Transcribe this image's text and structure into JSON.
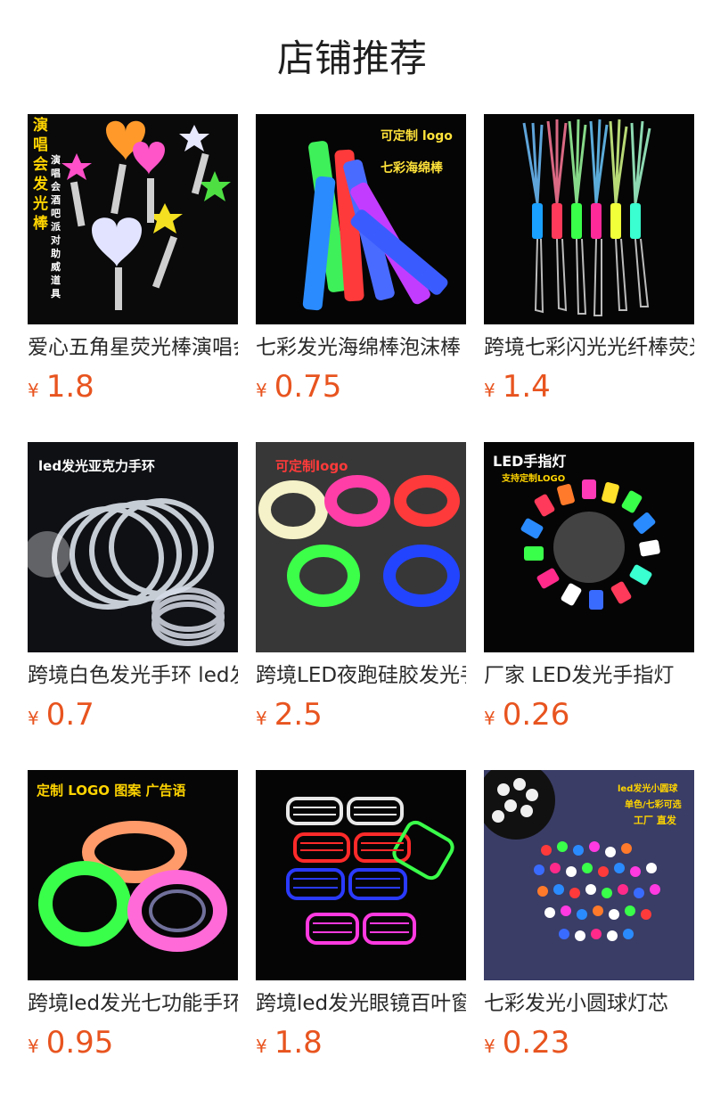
{
  "header": {
    "title": "店铺推荐"
  },
  "currency_symbol": "¥",
  "colors": {
    "price": "#e8541f",
    "title": "#1f1f1f",
    "name": "#2a2a2a"
  },
  "products": [
    {
      "name": "爱心五角星荧光棒演唱会酒吧派对助威道具",
      "price": "1.8",
      "image_text": [
        "演唱会发光棒",
        "演唱会酒吧派对助威道具"
      ],
      "icon": "heart-star-glow-stick-image"
    },
    {
      "name": "七彩发光海绵棒泡沫棒",
      "price": "0.75",
      "image_text": [
        "可定制 logo",
        "七彩海绵棒"
      ],
      "icon": "foam-stick-image"
    },
    {
      "name": "跨境七彩闪光光纤棒荧光棒",
      "price": "1.4",
      "image_text": [],
      "icon": "fiber-optic-wand-image"
    },
    {
      "name": "跨境白色发光手环 led发光亚克力手环",
      "price": "0.7",
      "image_text": [
        "led发光亚克力手环"
      ],
      "icon": "acrylic-bracelet-image"
    },
    {
      "name": "跨境LED夜跑硅胶发光手环",
      "price": "2.5",
      "image_text": [
        "可定制logo"
      ],
      "icon": "silicone-bracelet-image"
    },
    {
      "name": "厂家 LED发光手指灯",
      "price": "0.26",
      "image_text": [
        "LED手指灯",
        "支持定制LOGO"
      ],
      "icon": "finger-light-image"
    },
    {
      "name": "跨境led发光七功能手环",
      "price": "0.95",
      "image_text": [
        "定制 LOGO 图案 广告语"
      ],
      "icon": "led-wristband-image"
    },
    {
      "name": "跨境led发光眼镜百叶窗眼镜",
      "price": "1.8",
      "image_text": [],
      "icon": "shutter-glasses-image"
    },
    {
      "name": "七彩发光小圆球灯芯",
      "price": "0.23",
      "image_text": [
        "led发光小圆球",
        "单色/七彩可选",
        "工厂 直发"
      ],
      "icon": "led-ball-image"
    }
  ]
}
